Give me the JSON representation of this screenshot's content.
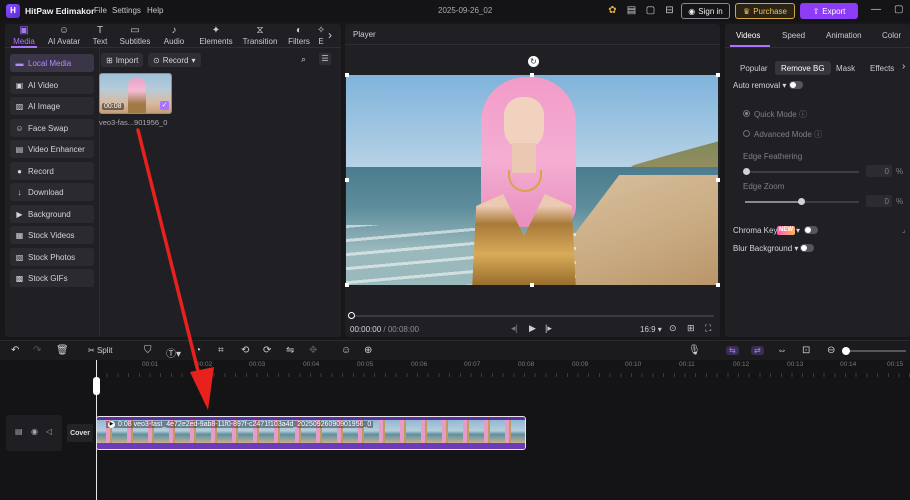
{
  "app": {
    "logo_text": "H",
    "title": "HitPaw Edimakor",
    "project_name": "2025-09-26_02"
  },
  "menu": [
    {
      "label": "File"
    },
    {
      "label": "Settings"
    },
    {
      "label": "Help"
    }
  ],
  "titlebar_buttons": {
    "signin": "Sign in",
    "purchase": "Purchase",
    "export": "Export"
  },
  "media_tabs": [
    {
      "label": "Media",
      "icon": "media-icon",
      "glyph": "▣",
      "active": true
    },
    {
      "label": "AI Avatar",
      "icon": "avatar-icon",
      "glyph": "☺"
    },
    {
      "label": "Text",
      "icon": "text-icon",
      "glyph": "T"
    },
    {
      "label": "Subtitles",
      "icon": "subtitles-icon",
      "glyph": "▭"
    },
    {
      "label": "Audio",
      "icon": "audio-icon",
      "glyph": "♪"
    },
    {
      "label": "Elements",
      "icon": "elements-icon",
      "glyph": "✦"
    },
    {
      "label": "Transition",
      "icon": "transition-icon",
      "glyph": "⧖"
    },
    {
      "label": "Filters",
      "icon": "filters-icon",
      "glyph": "◐"
    },
    {
      "label": "E",
      "icon": "effects-icon",
      "glyph": "✧"
    }
  ],
  "sidebar": {
    "items": [
      {
        "label": "Local Media",
        "glyph": "▬",
        "active": true
      },
      {
        "label": "AI Video",
        "glyph": "▣"
      },
      {
        "label": "AI Image",
        "glyph": "▨"
      },
      {
        "label": "Face Swap",
        "glyph": "☺"
      },
      {
        "label": "Video Enhancer",
        "glyph": "▤"
      },
      {
        "label": "Record",
        "glyph": "●"
      },
      {
        "label": "Download",
        "glyph": "↓"
      },
      {
        "label": "Background",
        "glyph": "▶"
      },
      {
        "label": "Stock Videos",
        "glyph": "▦"
      },
      {
        "label": "Stock Photos",
        "glyph": "▧"
      },
      {
        "label": "Stock GIFs",
        "glyph": "▩"
      }
    ]
  },
  "media": {
    "import_label": "Import",
    "record_label": "Record",
    "file": {
      "duration": "00:08",
      "name": "veo3-fas...901956_0"
    }
  },
  "player": {
    "title": "Player",
    "current_time": "00:00:00",
    "total_time": "00:08:00",
    "aspect": "16:9"
  },
  "right_panel": {
    "tabs": [
      {
        "label": "Videos",
        "active": true
      },
      {
        "label": "Speed"
      },
      {
        "label": "Animation"
      },
      {
        "label": "Color"
      }
    ],
    "subtabs": [
      {
        "label": "Popular"
      },
      {
        "label": "Remove BG",
        "active": true
      },
      {
        "label": "Mask"
      },
      {
        "label": "Effects"
      }
    ],
    "auto_removal": "Auto removal",
    "quick_mode": "Quick Mode",
    "advanced_mode": "Advanced Mode",
    "edge_feathering": "Edge Feathering",
    "edge_feathering_value": "0",
    "edge_zoom": "Edge Zoom",
    "edge_zoom_value": "0",
    "percent": "%",
    "chroma_key": "Chroma Key",
    "new_badge": "NEW",
    "blur_background": "Blur Background"
  },
  "timeline_toolbar": {
    "split_label": "Split"
  },
  "timeline": {
    "ruler": [
      "00:01",
      "00:02",
      "00:03",
      "00:04",
      "00:05",
      "00:06",
      "00:07",
      "00:08",
      "00:09",
      "00:10",
      "00:11",
      "00:12",
      "00:13",
      "00:14",
      "00:15"
    ],
    "cover_label": "Cover",
    "clip_label": "0:08 veo3-fast_4e72e2ed-9ab8-11f0-897f-c2471f103a4d_20250926090901956_0"
  },
  "colors": {
    "accent": "#a874ff",
    "export": "#8d3cf5",
    "purchase": "#f1c25c",
    "annotation_arrow": "#e8211c"
  }
}
